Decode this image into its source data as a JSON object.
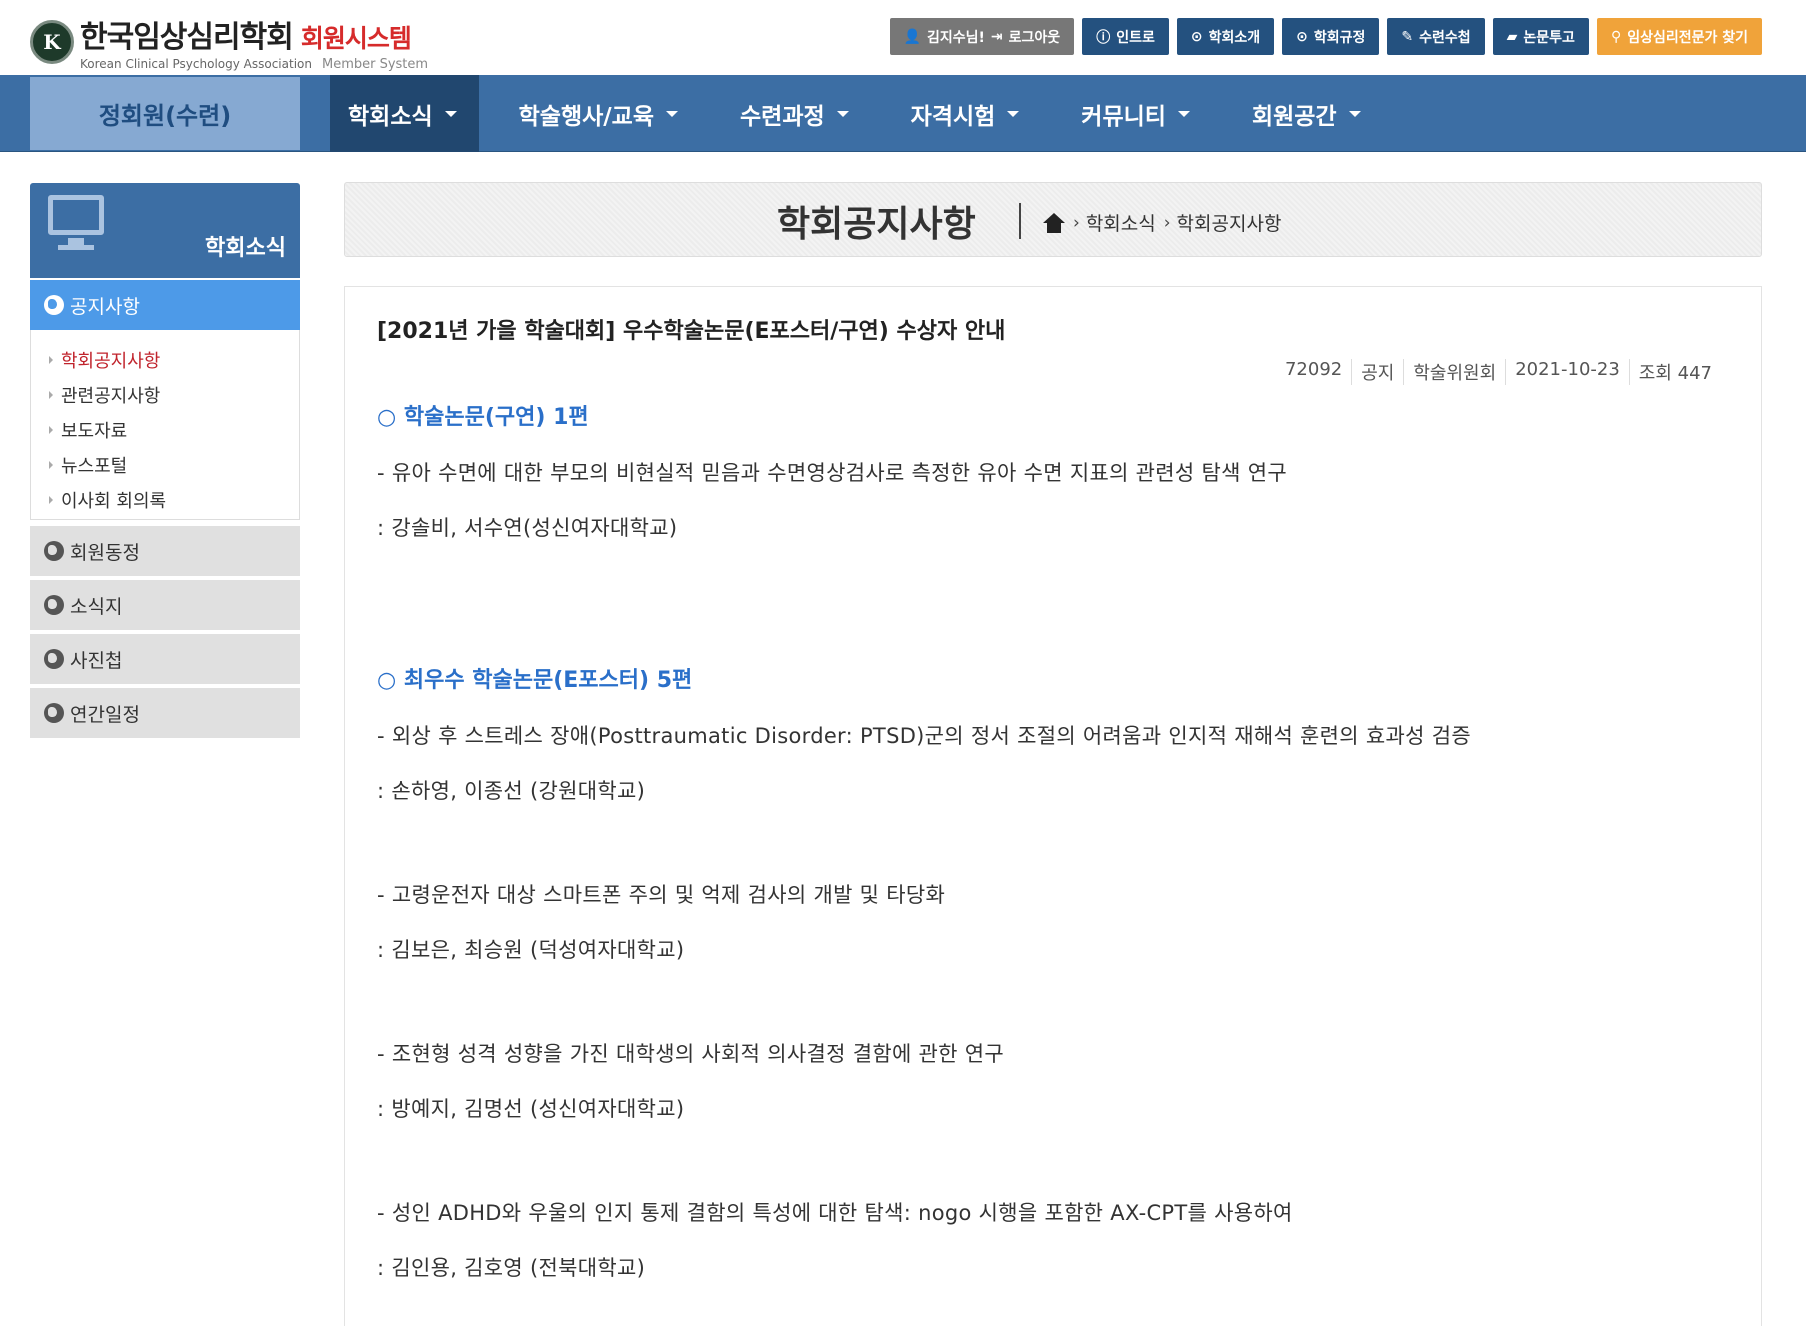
{
  "header": {
    "logo_mark": "K",
    "org_ko": "한국임상심리학회",
    "system_ko": "회원시스템",
    "org_en": "Korean Clinical Psychology Association",
    "system_en": "Member System",
    "buttons": [
      {
        "label": "김지수님!",
        "icon": "user-icon"
      },
      {
        "label": "로그아웃",
        "icon": "logout-icon"
      },
      {
        "label": "인트로",
        "icon": "info-icon"
      },
      {
        "label": "학회소개",
        "icon": "circle-arrow-icon"
      },
      {
        "label": "학회규정",
        "icon": "circle-arrow-icon"
      },
      {
        "label": "수련수첩",
        "icon": "pencil-icon"
      },
      {
        "label": "논문투고",
        "icon": "folder-icon"
      },
      {
        "label": "임상심리전문가 찾기",
        "icon": "search-icon"
      }
    ]
  },
  "nav": {
    "home": "정회원(수련)",
    "items": [
      {
        "label": "학회소식",
        "active": true
      },
      {
        "label": "학술행사/교육"
      },
      {
        "label": "수련과정"
      },
      {
        "label": "자격시험"
      },
      {
        "label": "커뮤니티"
      },
      {
        "label": "회원공간"
      }
    ]
  },
  "sidebar": {
    "title": "학회소식",
    "active": "공지사항",
    "sub_items": [
      "학회공지사항",
      "관련공지사항",
      "보도자료",
      "뉴스포털",
      "이사회 회의록"
    ],
    "other": [
      "회원동정",
      "소식지",
      "사진첩",
      "연간일정"
    ]
  },
  "page": {
    "title": "학회공지사항",
    "breadcrumb": [
      "학회소식",
      "학회공지사항"
    ]
  },
  "post": {
    "title": "[2021년 가을 학술대회] 우수학술논문(E포스터/구연) 수상자 안내",
    "meta": {
      "id": "72092",
      "type": "공지",
      "author": "학술위원회",
      "date": "2021-10-23",
      "views": "조회 447"
    },
    "sections": [
      "○ 학술논문(구연) 1편",
      "○ 최우수 학술논문(E포스터) 5편"
    ],
    "lines": [
      "- 유아 수면에 대한 부모의 비현실적 믿음과 수면영상검사로 측정한 유아 수면 지표의 관련성 탐색 연구",
      ": 강솔비, 서수연(성신여자대학교)",
      "- 외상 후 스트레스 장애(Posttraumatic Disorder: PTSD)군의 정서 조절의 어려움과 인지적 재해석 훈련의 효과성 검증",
      ": 손하영, 이종선 (강원대학교)",
      "- 고령운전자 대상 스마트폰 주의 및 억제 검사의 개발 및 타당화",
      ": 김보은, 최승원 (덕성여자대학교)",
      "- 조현형 성격 성향을 가진 대학생의 사회적 의사결정 결함에 관한 연구",
      ": 방예지, 김명선 (성신여자대학교)",
      "- 성인 ADHD와 우울의 인지 통제 결함의 특성에 대한 탐색: nogo 시행을 포함한 AX-CPT를 사용하여",
      ": 김인용, 김호영 (전북대학교)"
    ]
  },
  "colors": {
    "nav_bg": "#3c6ea4",
    "nav_active": "#21476f",
    "side_active": "#4d9ae8",
    "accent_red": "#c0232c",
    "section_blue": "#2a6fc9",
    "orange": "#f0a33a"
  }
}
